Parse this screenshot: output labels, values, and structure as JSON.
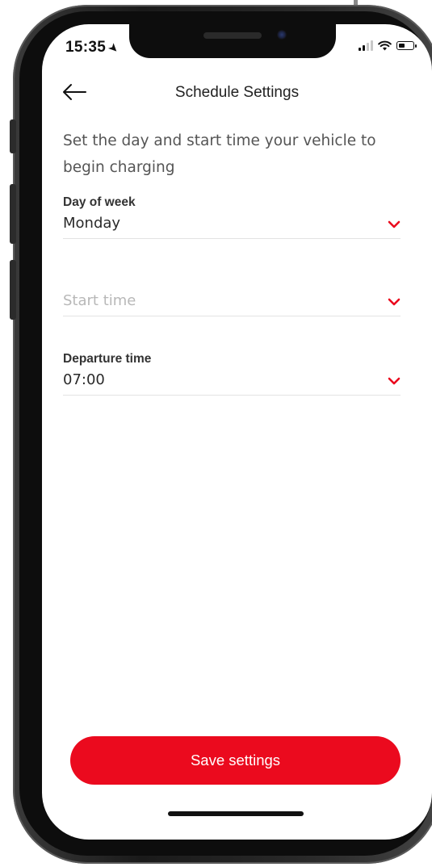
{
  "status_bar": {
    "time": "15:35",
    "location_icon": "location-arrow-icon",
    "signal_icon": "cellular-signal-icon",
    "wifi_icon": "wifi-icon",
    "battery_icon": "battery-icon",
    "battery_level": 0.45
  },
  "header": {
    "back_icon": "arrow-left-icon",
    "title": "Schedule Settings"
  },
  "intro_text": "Set the day and start time your vehicle to begin charging",
  "fields": {
    "day_of_week": {
      "label": "Day of week",
      "value": "Monday",
      "chevron_icon": "chevron-down-icon"
    },
    "start_time": {
      "label": "",
      "placeholder": "Start time",
      "value": "",
      "chevron_icon": "chevron-down-icon"
    },
    "departure_time": {
      "label": "Departure time",
      "value": "07:00",
      "chevron_icon": "chevron-down-icon"
    }
  },
  "save_button": {
    "label": "Save settings"
  },
  "colors": {
    "accent": "#eb0a1e",
    "text": "#2a2a2a",
    "placeholder": "#b8b8b8",
    "divider": "#e3e3e3"
  }
}
